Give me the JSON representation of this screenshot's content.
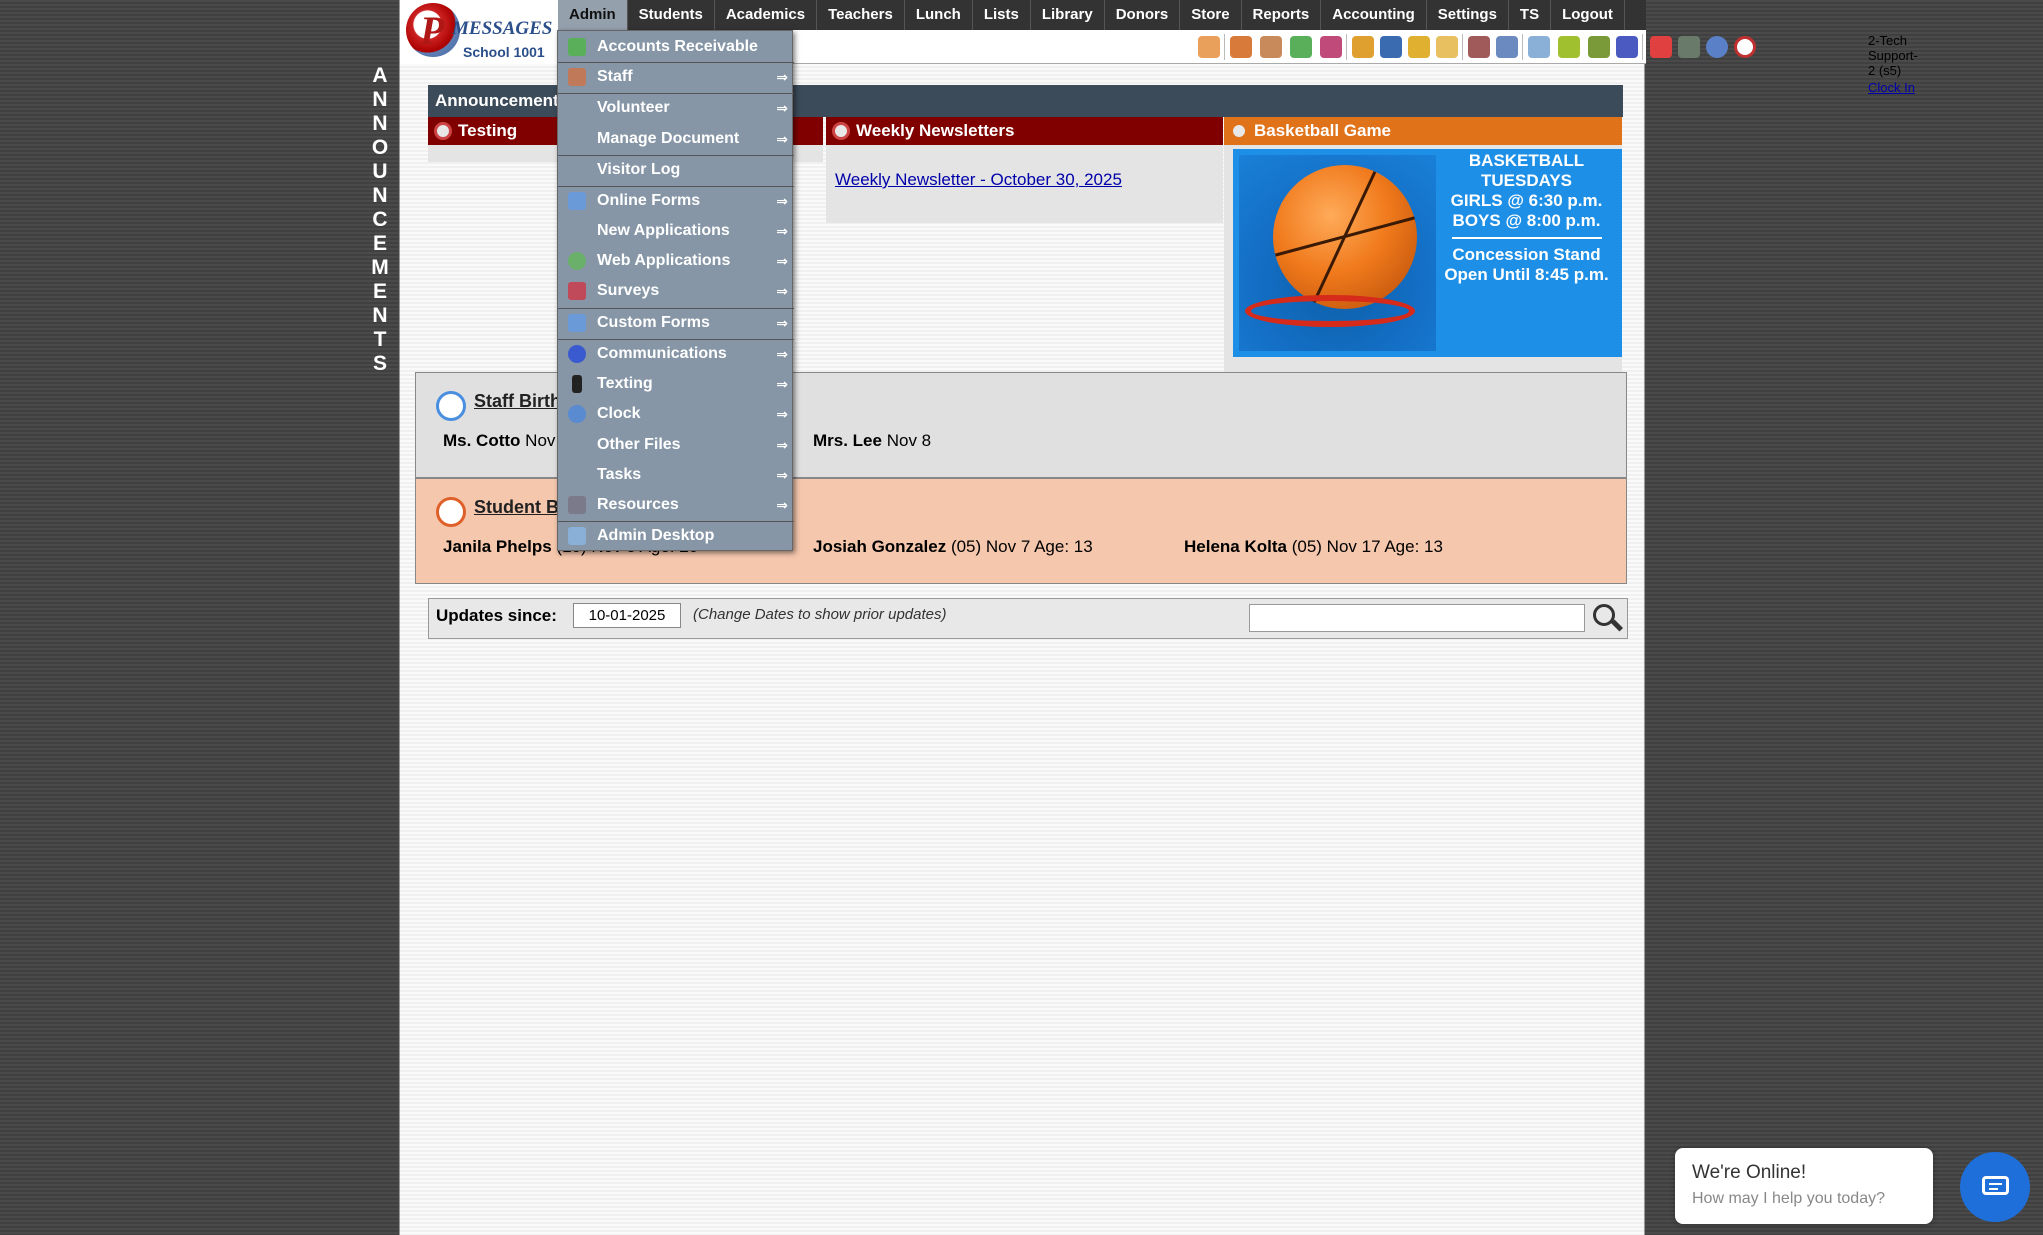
{
  "logo": {
    "letter": "P",
    "word": "MESSAGES",
    "school": "School 1001"
  },
  "topnav": [
    "Admin",
    "Students",
    "Academics",
    "Teachers",
    "Lunch",
    "Lists",
    "Library",
    "Donors",
    "Store",
    "Reports",
    "Accounting",
    "Settings",
    "TS",
    "Logout"
  ],
  "user": {
    "name": "2-Tech Support-2 (s5)",
    "clock": "Clock In"
  },
  "vertical_label": [
    "A",
    "N",
    "N",
    "O",
    "U",
    "N",
    "C",
    "E",
    "M",
    "E",
    "N",
    "T",
    "S"
  ],
  "announcements": {
    "heading": "Announcements",
    "cards": [
      "Testing",
      "Weekly Newsletters",
      "Basketball Game"
    ],
    "newsletter_link": "Weekly Newsletter - October 30, 2025",
    "basketball": {
      "line1": "BASKETBALL",
      "line2": "TUESDAYS",
      "line3": "GIRLS @ 6:30 p.m.",
      "line4": "BOYS  @ 8:00 p.m.",
      "line5": "Concession Stand",
      "line6": "Open Until 8:45 p.m."
    }
  },
  "staff_birthdays": {
    "title": "Staff Birthdays",
    "entries": [
      {
        "name": "Ms. Cotto",
        "date": "Nov"
      },
      {
        "name": "Mrs. Lee",
        "date": "Nov 8"
      }
    ]
  },
  "student_birthdays": {
    "title": "Student Birthdays",
    "entries": [
      {
        "name": "Janila Phelps",
        "info": "(10) Nov 5 Age: 20"
      },
      {
        "name": "Josiah Gonzalez",
        "info": "(05) Nov 7 Age: 13"
      },
      {
        "name": "Helena Kolta",
        "info": "(05) Nov 17 Age: 13"
      }
    ]
  },
  "updates": {
    "label": "Updates since:",
    "date": "10-01-2025",
    "note": "(Change Dates to show prior updates)",
    "search_value": ""
  },
  "admin_menu": [
    {
      "label": "Accounts Receivable",
      "arrow": "",
      "icon": "money-icon"
    },
    {
      "label": "Staff",
      "arrow": "⇒",
      "icon": "person-icon"
    },
    {
      "label": "Volunteer",
      "arrow": "⇒",
      "icon": ""
    },
    {
      "label": "Manage Document",
      "arrow": "⇒",
      "icon": ""
    },
    {
      "label": "Visitor Log",
      "arrow": "",
      "icon": ""
    },
    {
      "label": "Online Forms",
      "arrow": "⇒",
      "icon": "form-icon"
    },
    {
      "label": "New Applications",
      "arrow": "⇒",
      "icon": ""
    },
    {
      "label": "Web Applications",
      "arrow": "⇒",
      "icon": "globe-icon"
    },
    {
      "label": "Surveys",
      "arrow": "⇒",
      "icon": "survey-icon"
    },
    {
      "label": "Custom Forms",
      "arrow": "⇒",
      "icon": "form-icon"
    },
    {
      "label": "Communications",
      "arrow": "⇒",
      "icon": "at-icon"
    },
    {
      "label": "Texting",
      "arrow": "⇒",
      "icon": "phone-icon"
    },
    {
      "label": "Clock",
      "arrow": "⇒",
      "icon": "clock-icon"
    },
    {
      "label": "Other Files",
      "arrow": "⇒",
      "icon": ""
    },
    {
      "label": "Tasks",
      "arrow": "⇒",
      "icon": ""
    },
    {
      "label": "Resources",
      "arrow": "⇒",
      "icon": "book-icon"
    },
    {
      "label": "Admin Desktop",
      "arrow": "",
      "icon": "desktop-icon"
    }
  ],
  "chat": {
    "title": "We're Online!",
    "subtitle": "How may I help you today?"
  },
  "colors": {
    "nav_bg": "#333333",
    "menu_bg": "#8696a6",
    "dark_red": "#800000",
    "orange": "#e0721a",
    "chat_blue": "#1e6fd9"
  }
}
